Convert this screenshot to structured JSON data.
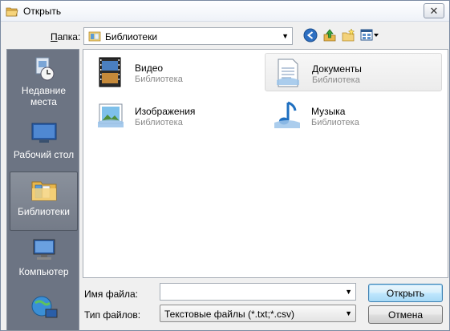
{
  "window": {
    "title": "Открыть"
  },
  "toolbar": {
    "lookin_label": "Папка:",
    "lookin_value": "Библиотеки",
    "back_icon": "back-arrow-icon",
    "up_icon": "up-folder-icon",
    "newfolder_icon": "new-folder-icon",
    "views_icon": "view-menu-icon"
  },
  "places": [
    {
      "label": "Недавние места",
      "icon": "recent-places-icon"
    },
    {
      "label": "Рабочий стол",
      "icon": "desktop-icon"
    },
    {
      "label": "Библиотеки",
      "icon": "libraries-icon",
      "selected": true
    },
    {
      "label": "Компьютер",
      "icon": "computer-icon"
    },
    {
      "label": "",
      "icon": "network-icon"
    }
  ],
  "files": [
    {
      "name": "Видео",
      "type": "Библиотека",
      "icon": "video-library-icon"
    },
    {
      "name": "Документы",
      "type": "Библиотека",
      "icon": "documents-library-icon"
    },
    {
      "name": "Изображения",
      "type": "Библиотека",
      "icon": "pictures-library-icon"
    },
    {
      "name": "Музыка",
      "type": "Библиотека",
      "icon": "music-library-icon"
    }
  ],
  "form": {
    "filename_label": "Имя файла:",
    "filename_value": "",
    "filetype_label": "Тип файлов:",
    "filetype_value": "Текстовые файлы (*.txt;*.csv)"
  },
  "buttons": {
    "open": "Открыть",
    "cancel": "Отмена"
  }
}
